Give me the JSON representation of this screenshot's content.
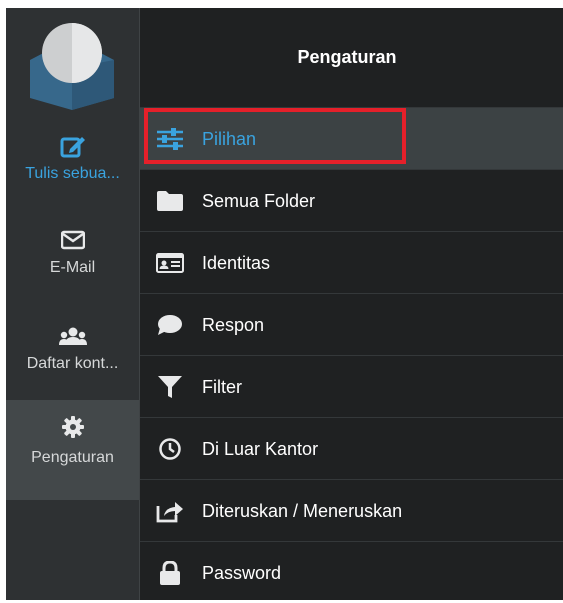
{
  "rail": {
    "items": [
      {
        "label": "Tulis sebua...",
        "icon": "compose-icon"
      },
      {
        "label": "E-Mail",
        "icon": "envelope-icon"
      },
      {
        "label": "Daftar kont...",
        "icon": "contacts-icon"
      },
      {
        "label": "Pengaturan",
        "icon": "gear-icon"
      }
    ]
  },
  "panel": {
    "title": "Pengaturan",
    "items": [
      {
        "label": "Pilihan",
        "icon": "sliders-icon"
      },
      {
        "label": "Semua Folder",
        "icon": "folder-icon"
      },
      {
        "label": "Identitas",
        "icon": "id-card-icon"
      },
      {
        "label": "Respon",
        "icon": "speech-bubble-icon"
      },
      {
        "label": "Filter",
        "icon": "funnel-icon"
      },
      {
        "label": "Di Luar Kantor",
        "icon": "clock-icon"
      },
      {
        "label": "Diteruskan / Meneruskan",
        "icon": "share-icon"
      },
      {
        "label": "Password",
        "icon": "lock-icon"
      }
    ]
  },
  "colors": {
    "accent": "#3aa3df",
    "highlight": "#e5202a",
    "rail_bg": "#2e3133",
    "panel_bg": "#1f2122"
  }
}
